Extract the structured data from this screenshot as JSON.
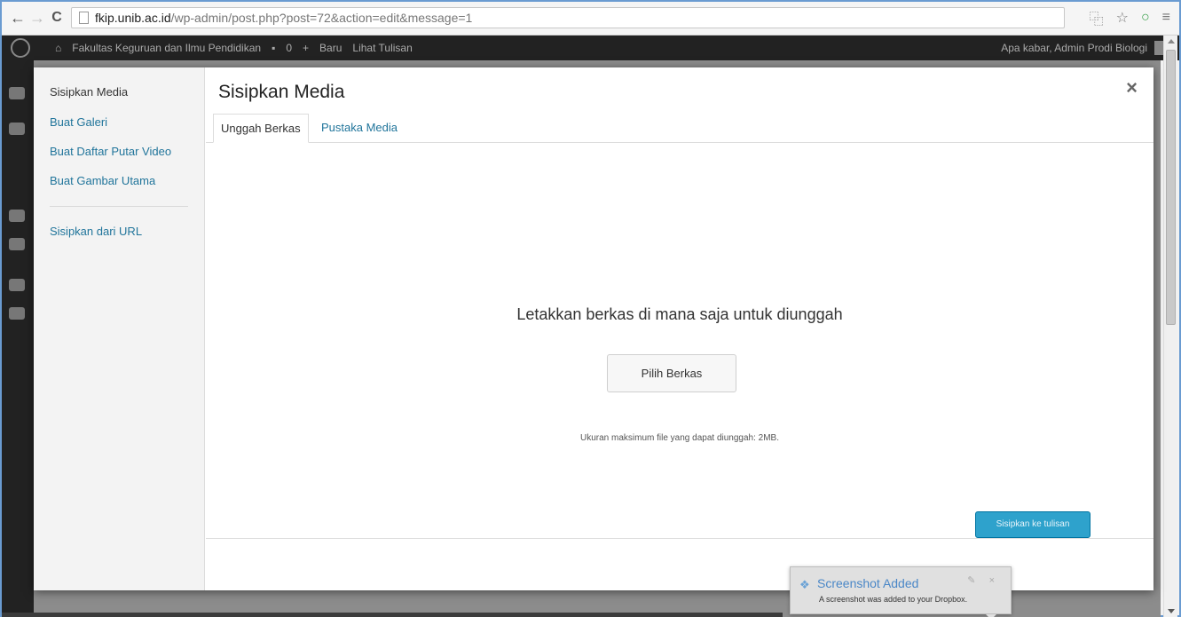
{
  "browser": {
    "url_host": "fkip.unib.ac.id",
    "url_path": "/wp-admin/post.php?post=72&action=edit&message=1",
    "icons": [
      "back-arrow-icon",
      "forward-arrow-icon",
      "reload-icon",
      "page-icon",
      "translate-icon",
      "star-icon",
      "opera-icon",
      "menu-icon"
    ]
  },
  "adminbar": {
    "site_name": "Fakultas Keguruan dan Ilmu Pendidikan",
    "comments_count": "0",
    "new_label": "Baru",
    "view_label": "Lihat Tulisan",
    "greeting": "Apa kabar, Admin Prodi Biologi"
  },
  "modal": {
    "sidebar": {
      "heading": "Sisipkan Media",
      "links": [
        "Buat Galeri",
        "Buat Daftar Putar Video",
        "Buat Gambar Utama",
        "Sisipkan dari URL"
      ]
    },
    "title": "Sisipkan Media",
    "close": "×",
    "tabs": [
      {
        "label": "Unggah Berkas",
        "active": true
      },
      {
        "label": "Pustaka Media",
        "active": false
      }
    ],
    "drop_message": "Letakkan berkas di mana saja untuk diunggah",
    "select_button": "Pilih Berkas",
    "max_size_text": "Ukuran maksimum file yang dapat diunggah: 2MB.",
    "insert_button": "Sisipkan ke tulisan"
  },
  "notification": {
    "title": "Screenshot Added",
    "text": "A screenshot was added to your Dropbox.",
    "controls": "✎ ×"
  },
  "colors": {
    "accent_link": "#21759b",
    "primary_button": "#2ea2cc",
    "adminbar_bg": "#222222",
    "backdrop": "#8c8c8c"
  }
}
